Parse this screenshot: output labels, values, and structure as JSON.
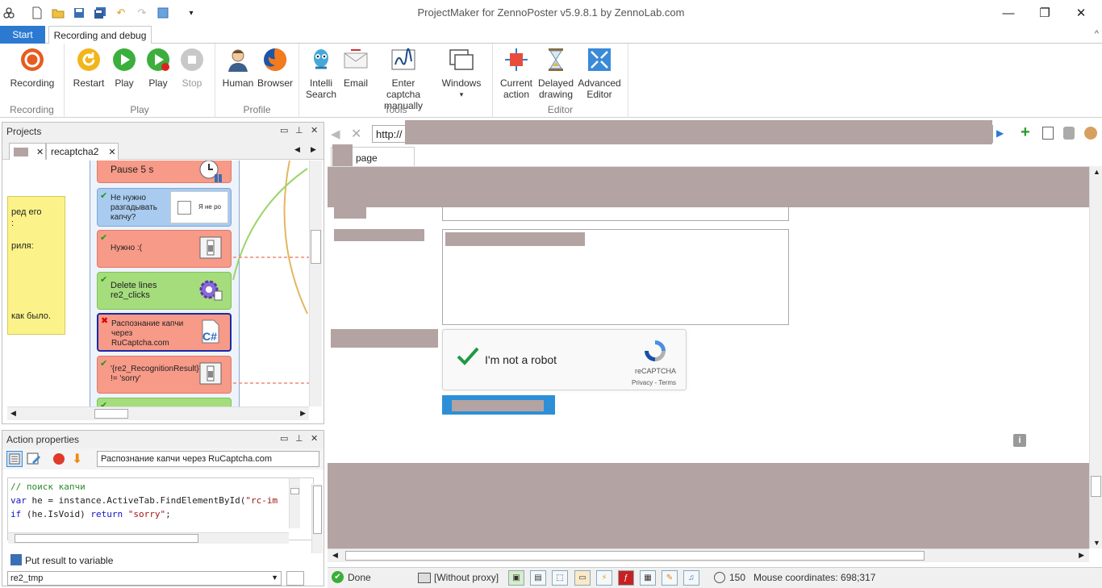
{
  "window": {
    "title": "ProjectMaker for ZennoPoster v5.9.8.1 by ZennoLab.com",
    "minimize": "—",
    "restore": "❐",
    "close": "✕"
  },
  "ribbon_tabs": {
    "start": "Start",
    "recording": "Recording and debug",
    "collapse": "^"
  },
  "ribbon": {
    "groups": {
      "recording": "Recording",
      "play": "Play",
      "profile": "Profile",
      "tools": "Tools",
      "editor": "Editor"
    },
    "buttons": {
      "recording": "Recording",
      "restart": "Restart",
      "play1": "Play",
      "play2": "Play",
      "stop": "Stop",
      "human": "Human",
      "browser": "Browser",
      "intelli_search": "Intelli Search",
      "email": "Email",
      "enter_captcha": "Enter captcha manually",
      "windows": "Windows",
      "windows_arrow": "▾",
      "current_action": "Current action",
      "delayed_drawing": "Delayed drawing",
      "advanced_editor": "Advanced Editor"
    }
  },
  "projects": {
    "title": "Projects",
    "tab": "recaptcha2",
    "note_lines": [
      "ред его",
      ":",
      "риля:",
      "как было."
    ],
    "blocks": {
      "pause": "Pause 5 s",
      "no_need": "Не нужно разгадывать капчу?",
      "checkbox_text": "Я не ро",
      "need": "Нужно :(",
      "delete_lines": "Delete lines re2_clicks",
      "recognition": "Распознание капчи через RuCaptcha.com",
      "condition": "'{re2_RecognitionResult}' != 'sorry'"
    }
  },
  "action": {
    "title": "Action properties",
    "name_value": "Распознание капчи через RuCaptcha.com",
    "code": {
      "line1": "// поиск капчи",
      "line2_a": "var",
      "line2_b": " he = instance.ActiveTab.FindElementById(",
      "line2_c": "\"rc-im",
      "line3_a": "if",
      "line3_b": " (he.IsVoid) ",
      "line3_c": "return",
      "line3_d": " ",
      "line3_e": "\"sorry\"",
      "line3_f": ";"
    },
    "put_result_label": "Put result to variable",
    "variable_value": "re2_tmp"
  },
  "browser": {
    "url": "http://",
    "tab_label": "page",
    "captcha": {
      "label": "I'm not a robot",
      "brand": "reCAPTCHA",
      "links": "Privacy - Terms"
    }
  },
  "status": {
    "done": "Done",
    "proxy": "[Without proxy]",
    "timer": "150",
    "mouse": "Mouse coordinates: 698;317"
  },
  "colors": {
    "accent": "#2b79d0",
    "redacted": "#b3a3a3",
    "block_red": "#f79a88",
    "block_green": "#a5dd7d",
    "block_blue": "#a8cbef",
    "note_yellow": "#fbf38a"
  }
}
